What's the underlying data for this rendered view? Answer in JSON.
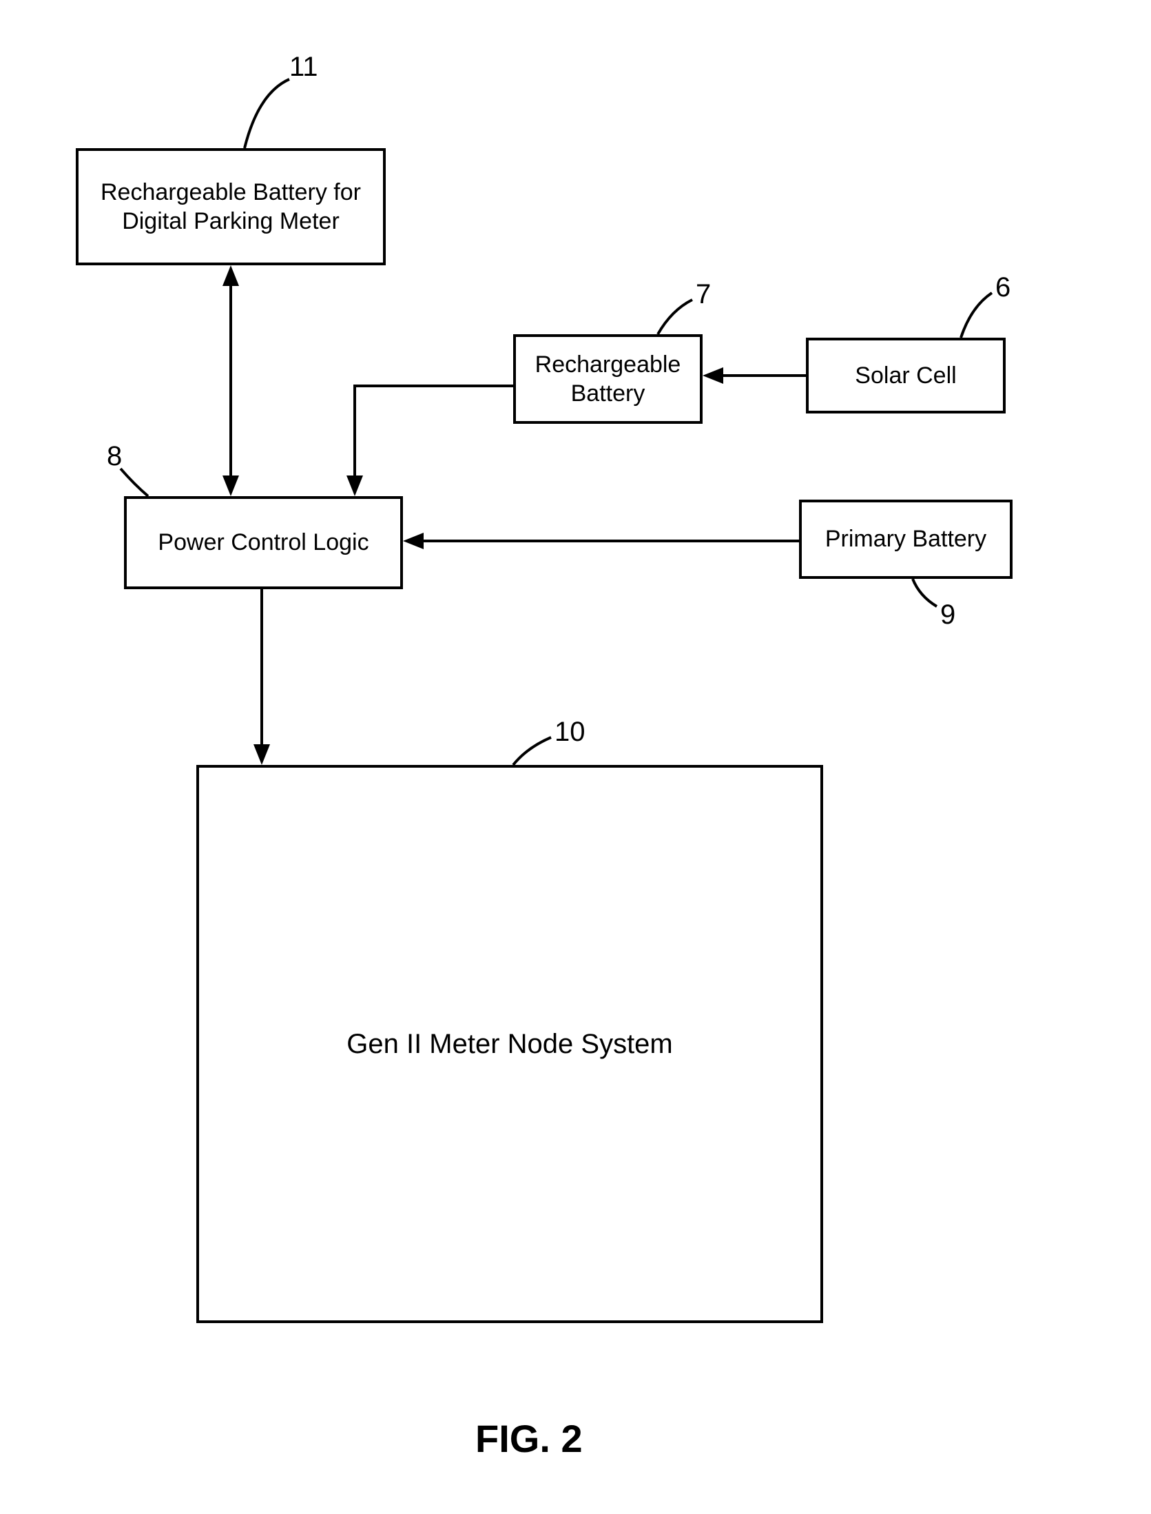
{
  "figure_label": "FIG. 2",
  "blocks": {
    "b11": {
      "label": "Rechargeable Battery for\nDigital Parking Meter",
      "ref": "11"
    },
    "b7": {
      "label": "Rechargeable\nBattery",
      "ref": "7"
    },
    "b6": {
      "label": "Solar Cell",
      "ref": "6"
    },
    "b8": {
      "label": "Power Control Logic",
      "ref": "8"
    },
    "b9": {
      "label": "Primary Battery",
      "ref": "9"
    },
    "b10": {
      "label": "Gen II Meter Node System",
      "ref": "10"
    }
  }
}
